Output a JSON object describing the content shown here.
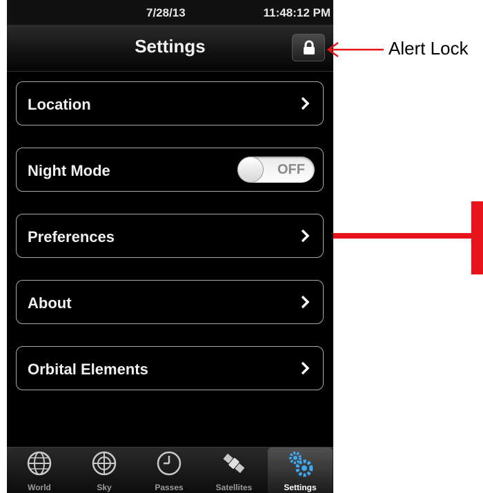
{
  "status_bar": {
    "date": "7/28/13",
    "time": "11:48:12 PM"
  },
  "nav_bar": {
    "title": "Settings",
    "lock_icon": "lock-icon"
  },
  "settings_list": [
    {
      "label": "Location",
      "accessory": "chevron"
    },
    {
      "label": "Night Mode",
      "accessory": "toggle",
      "toggle_state": "OFF"
    },
    {
      "label": "Preferences",
      "accessory": "chevron"
    },
    {
      "label": "About",
      "accessory": "chevron"
    },
    {
      "label": "Orbital Elements",
      "accessory": "chevron"
    }
  ],
  "tab_bar": {
    "items": [
      {
        "label": "World",
        "icon": "globe-icon"
      },
      {
        "label": "Sky",
        "icon": "sky-grid-icon"
      },
      {
        "label": "Passes",
        "icon": "clock-icon"
      },
      {
        "label": "Satellites",
        "icon": "satellite-icon"
      },
      {
        "label": "Settings",
        "icon": "gears-icon",
        "active": true
      }
    ]
  },
  "annotation": {
    "label": "Alert Lock",
    "arrow_color": "#e8141b"
  },
  "colors": {
    "accent_active_tab": "#3fa9f5",
    "pointer_arrow": "#e8141b"
  }
}
